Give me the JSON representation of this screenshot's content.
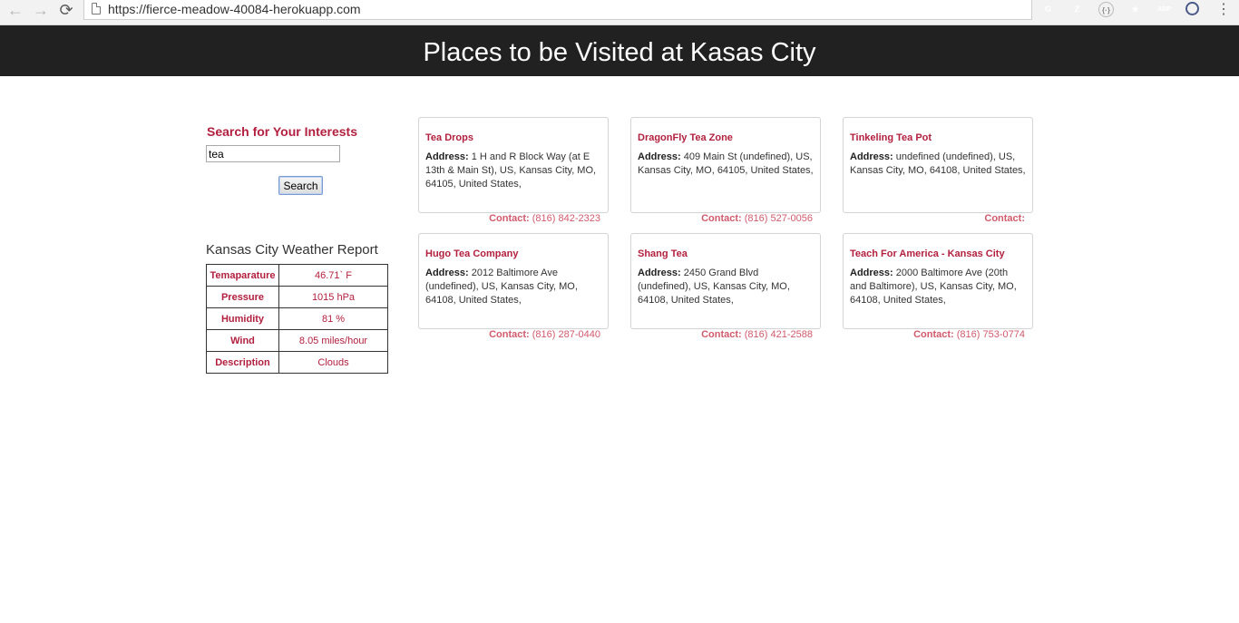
{
  "browser": {
    "url": "https://fierce-meadow-40084-herokuapp.com",
    "back_glyph": "←",
    "forward_glyph": "→",
    "reload_glyph": "⟳",
    "menu_glyph": "⋮",
    "extensions": [
      {
        "icon": "grammarly-icon",
        "glyph": "G",
        "color": "#15c39a"
      },
      {
        "icon": "zotero-icon",
        "glyph": "Z",
        "color": "#3b5ba5"
      },
      {
        "icon": "code-icon",
        "glyph": "{·}",
        "color": "#d8d8d8"
      },
      {
        "icon": "night-sky-icon",
        "glyph": "★",
        "color": "#2b3a7a"
      },
      {
        "icon": "adblock-plus-icon",
        "glyph": "ABP",
        "color": "#d11a1a"
      },
      {
        "icon": "block-icon",
        "glyph": "⃠",
        "color": "#ffffff"
      }
    ]
  },
  "header": {
    "title": "Places to be Visited at Kasas City",
    "background": "#212121"
  },
  "search": {
    "heading": "Search for Your Interests",
    "value": "tea",
    "button_label": "Search"
  },
  "weather": {
    "heading": "Kansas City Weather Report",
    "rows": [
      {
        "label": "Temaparature",
        "value": "46.71` F"
      },
      {
        "label": "Pressure",
        "value": "1015 hPa"
      },
      {
        "label": "Humidity",
        "value": "81 %"
      },
      {
        "label": "Wind",
        "value": "8.05 miles/hour"
      },
      {
        "label": "Description",
        "value": "Clouds"
      }
    ]
  },
  "places": [
    {
      "name": "Tea Drops",
      "address_label": "Address:",
      "address": "1 H and R Block Way (at E 13th & Main St), US, Kansas City, MO, 64105, United States,",
      "contact_label": "Contact:",
      "phone": "(816) 842-2323"
    },
    {
      "name": "DragonFly Tea Zone",
      "address_label": "Address:",
      "address": "409 Main St (undefined), US, Kansas City, MO, 64105, United States,",
      "contact_label": "Contact:",
      "phone": "(816) 527-0056"
    },
    {
      "name": "Tinkeling Tea Pot",
      "address_label": "Address:",
      "address": "undefined (undefined), US, Kansas City, MO, 64108, United States,",
      "contact_label": "Contact:",
      "phone": ""
    },
    {
      "name": "Hugo Tea Company",
      "address_label": "Address:",
      "address": "2012 Baltimore Ave (undefined), US, Kansas City, MO, 64108, United States,",
      "contact_label": "Contact:",
      "phone": "(816) 287-0440"
    },
    {
      "name": "Shang Tea",
      "address_label": "Address:",
      "address": "2450 Grand Blvd (undefined), US, Kansas City, MO, 64108, United States,",
      "contact_label": "Contact:",
      "phone": "(816) 421-2588"
    },
    {
      "name": "Teach For America - Kansas City",
      "address_label": "Address:",
      "address": "2000 Baltimore Ave (20th and Baltimore), US, Kansas City, MO, 64108, United States,",
      "contact_label": "Contact:",
      "phone": "(816) 753-0774"
    }
  ],
  "colors": {
    "accent": "#b3203f",
    "contact": "#d15a6c"
  }
}
